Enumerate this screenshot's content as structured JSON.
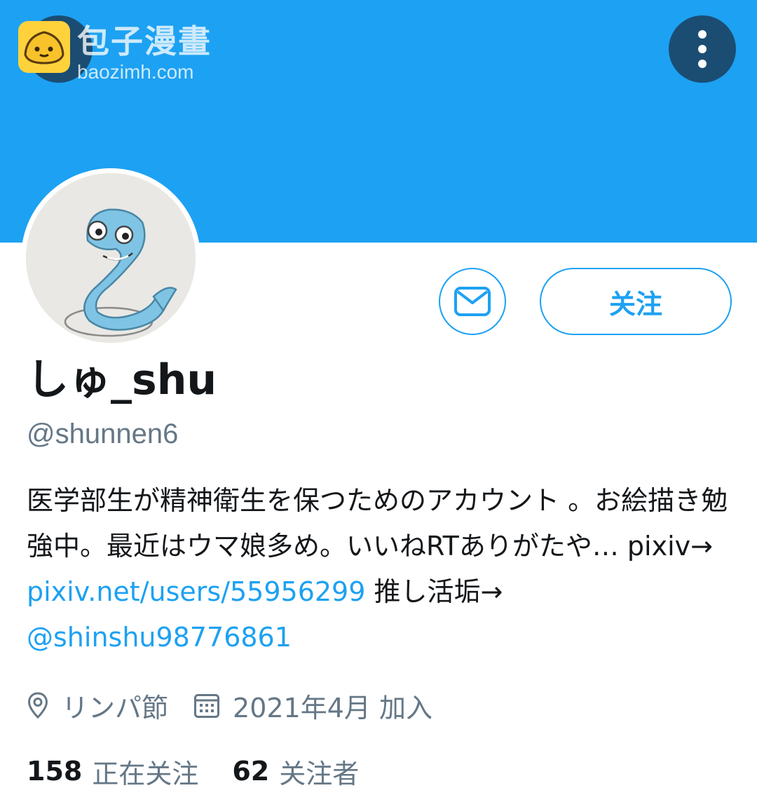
{
  "watermark": {
    "title": "包子漫畫",
    "url": "baozimh.com"
  },
  "header": {
    "back_icon": "arrow-left-icon",
    "more_icon": "more-vertical-icon"
  },
  "profile": {
    "display_name": "しゅ_shu",
    "handle": "@shunnen6",
    "follow_label": "关注",
    "message_icon": "mail-icon"
  },
  "bio": {
    "text_1": "医学部生が精神衛生を保つためのアカウント 。お絵描き勉強中。最近はウマ娘多め。いいねRTありがたや… pixiv→ ",
    "link_1": "pixiv.net/users/55956299",
    "text_2": " 推し活垢→ ",
    "link_2": "@shinshu98776861"
  },
  "meta": {
    "location": "リンパ節",
    "location_icon": "location-pin-icon",
    "joined": "2021年4月 加入",
    "joined_icon": "calendar-icon"
  },
  "stats": {
    "following_count": "158",
    "following_label": "正在关注",
    "followers_count": "62",
    "followers_label": "关注者"
  },
  "colors": {
    "accent": "#1da1f2",
    "banner": "#1da1f2",
    "secondary_text": "#657786",
    "button_dark": "#1b4d73"
  }
}
